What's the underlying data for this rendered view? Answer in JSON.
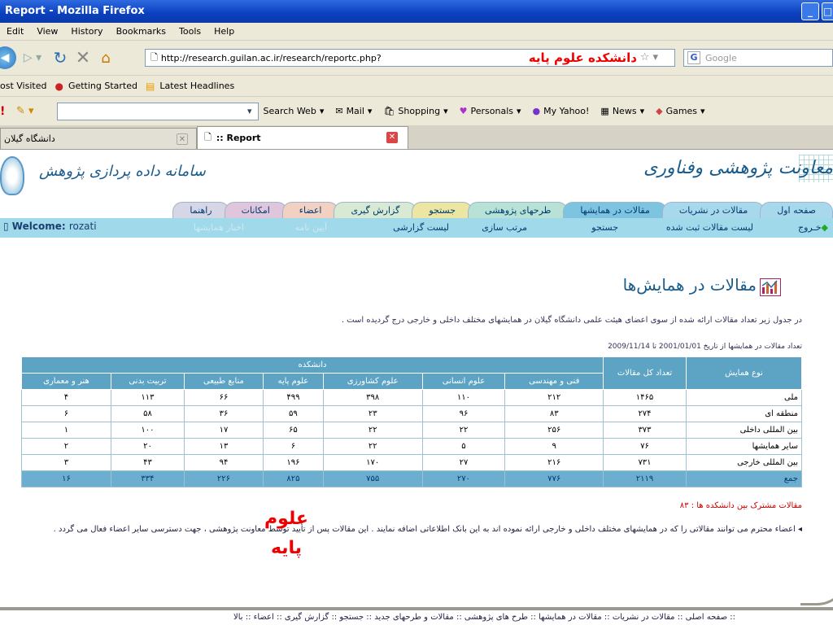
{
  "window": {
    "title": "Report - Mozilla Firefox"
  },
  "menu": [
    "Edit",
    "View",
    "History",
    "Bookmarks",
    "Tools",
    "Help"
  ],
  "nav": {
    "url": "http://research.guilan.ac.ir/research/reportc.php?",
    "url_overlay": "دانشکده علوم پایه",
    "search_placeholder": "Google",
    "search_engine_icon": "G"
  },
  "bookmarks": [
    "ost Visited",
    "Getting Started",
    "Latest Headlines"
  ],
  "yahoo_toolbar": [
    "Search Web",
    "Mail",
    "Shopping",
    "Personals",
    "My Yahoo!",
    "News",
    "Games"
  ],
  "tabs": [
    {
      "label": "دانشگاه گیلان",
      "active": false
    },
    {
      "label": ":: Report",
      "active": true
    }
  ],
  "site": {
    "logo_right": "معاونت پژوهشی وفناوری",
    "logo_left": "سامانه داده پردازی پژوهش",
    "nav_tabs": [
      {
        "label": "صفحه اول",
        "color": "#a8d8ec"
      },
      {
        "label": "مقالات در نشریات",
        "color": "#a8d8ec"
      },
      {
        "label": "مقالات در همایشها",
        "color": "#7cc4e0"
      },
      {
        "label": "طرحهای پژوهشی",
        "color": "#b7e2d5"
      },
      {
        "label": "جستجو",
        "color": "#ece6a2"
      },
      {
        "label": "گزارش گیری",
        "color": "#d8ead3"
      },
      {
        "label": "اعضاء",
        "color": "#f2d0c2"
      },
      {
        "label": "امکانات",
        "color": "#e0c6dc"
      },
      {
        "label": "راهنما",
        "color": "#d6d6e6"
      }
    ],
    "sub_menu": {
      "exit": "خـروج",
      "items": [
        "لیست مقالات ثبت شده",
        "جستجو",
        "مرتب سازی",
        "لیست گزارشی"
      ],
      "faint_items": [
        "آیین نامه",
        "اخبار همایشها"
      ],
      "welcome_label": "Welcome:",
      "welcome_user": "rozati"
    }
  },
  "content": {
    "heading": "مقالات در همایش‌ها",
    "description": "در جدول زیر تعداد مقالات ارائه شده از سوی اعضای هیئت علمی دانشگاه گیلان در همایشهای مختلف داخلی و خارجی درج گردیده است .",
    "count_line": "تعداد مقالات در همایشها از تاریخ  2001/01/01  تا  2009/11/14",
    "table": {
      "col_type": "نوع همایش",
      "col_total": "تعداد کل مقالات",
      "col_group": "دانشکده",
      "faculties": [
        "فنی و مهندسی",
        "علوم انسانی",
        "علوم کشاورزی",
        "علوم پایه",
        "منابع طبیعی",
        "تربیت بدنی",
        "هنر و معماری"
      ],
      "rows": [
        {
          "type": "ملی",
          "total": "۱۴۶۵",
          "values": [
            "۲۱۲",
            "۱۱۰",
            "۳۹۸",
            "۴۹۹",
            "۶۶",
            "۱۱۳",
            "۴"
          ]
        },
        {
          "type": "منطقه ای",
          "total": "۲۷۴",
          "values": [
            "۸۳",
            "۹۶",
            "۲۳",
            "۵۹",
            "۳۶",
            "۵۸",
            "۶"
          ]
        },
        {
          "type": "بین المللی داخلی",
          "total": "۳۷۳",
          "values": [
            "۲۵۶",
            "۲۲",
            "۲۲",
            "۶۵",
            "۱۷",
            "۱۰۰",
            "۱"
          ]
        },
        {
          "type": "سایر همایشها",
          "total": "۷۶",
          "values": [
            "۹",
            "۵",
            "۲۲",
            "۶",
            "۱۳",
            "۲۰",
            "۲"
          ]
        },
        {
          "type": "بین المللی خارجی",
          "total": "۷۳۱",
          "values": [
            "۲۱۶",
            "۲۷",
            "۱۷۰",
            "۱۹۶",
            "۹۴",
            "۴۳",
            "۳"
          ]
        }
      ],
      "total_row": {
        "type": "جمع",
        "total": "۲۱۱۹",
        "values": [
          "۷۷۶",
          "۲۷۰",
          "۷۵۵",
          "۸۲۵",
          "۲۲۶",
          "۳۳۴",
          "۱۶"
        ]
      }
    },
    "shared": "مقالات مشترک بین دانشکده ها : ۸۳",
    "note": "اعضاء محترم می توانند مقالاتی را که در همایشهای مختلف داخلی و خارجی ارائه نموده اند به این بانک اطلاعاتی اضافه نمایند . این مقالات پس از تأیید توسط معاونت پژوهشی ، جهت دسترسی سایر اعضاء فعال می گردد .",
    "red_annotation": "علوم پایه",
    "footer": ":: صفحه اصلی :: مقالات در نشریات :: مقالات در همایشها :: طرح های پژوهشی :: مقالات و طرحهای جدید :: جستجو :: گزارش گیری :: اعضاء :: بالا"
  }
}
